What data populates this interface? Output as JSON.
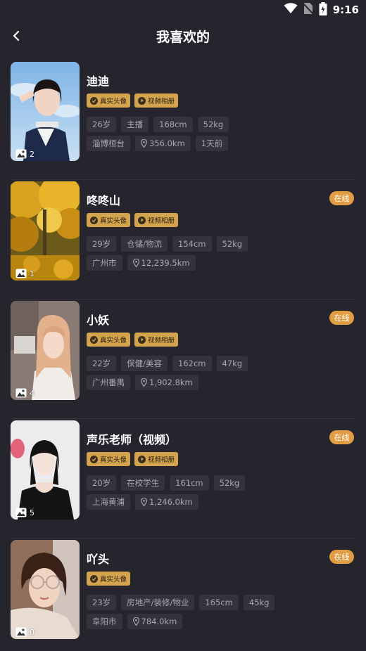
{
  "status": {
    "time": "9:16"
  },
  "header": {
    "title": "我喜欢的"
  },
  "badges": {
    "real_avatar": "真实头像",
    "video_album": "视频相册"
  },
  "online_label": "在线",
  "profiles": [
    {
      "name": "迪迪",
      "photo_count": "2",
      "online": false,
      "video": true,
      "age": "26岁",
      "job": "主播",
      "height": "168cm",
      "weight": "52kg",
      "city": "淄博桓台",
      "distance": "356.0km",
      "last_seen": "1天前"
    },
    {
      "name": "咚咚山",
      "photo_count": "1",
      "online": true,
      "video": true,
      "age": "29岁",
      "job": "仓储/物流",
      "height": "154cm",
      "weight": "52kg",
      "city": "广州市",
      "distance": "12,239.5km",
      "last_seen": ""
    },
    {
      "name": "小妖",
      "photo_count": "4",
      "online": true,
      "video": true,
      "age": "22岁",
      "job": "保健/美容",
      "height": "162cm",
      "weight": "47kg",
      "city": "广州番禺",
      "distance": "1,902.8km",
      "last_seen": ""
    },
    {
      "name": "声乐老师（视频）",
      "photo_count": "5",
      "online": true,
      "video": true,
      "age": "20岁",
      "job": "在校学生",
      "height": "161cm",
      "weight": "52kg",
      "city": "上海黄浦",
      "distance": "1,246.0km",
      "last_seen": ""
    },
    {
      "name": "吖头",
      "photo_count": "0",
      "online": true,
      "video": false,
      "age": "23岁",
      "job": "房地产/装修/物业",
      "height": "165cm",
      "weight": "45kg",
      "city": "阜阳市",
      "distance": "784.0km",
      "last_seen": ""
    }
  ]
}
